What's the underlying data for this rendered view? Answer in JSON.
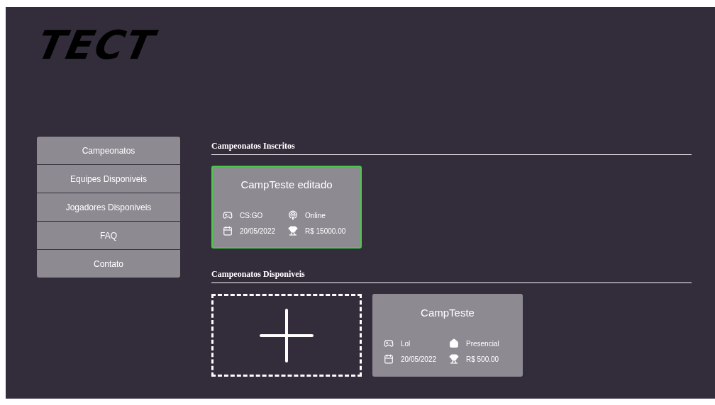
{
  "logo": {
    "text": "TECT"
  },
  "sidebar": {
    "items": [
      {
        "label": "Campeonatos"
      },
      {
        "label": "Equipes Disponiveis"
      },
      {
        "label": "Jogadores Disponiveis"
      },
      {
        "label": "FAQ"
      },
      {
        "label": "Contato"
      }
    ]
  },
  "sections": [
    {
      "title": "Campeonatos Inscritos",
      "add_card": false,
      "cards": [
        {
          "title": "CampTeste editado",
          "highlighted": true,
          "details": [
            {
              "kind": "game",
              "text": "CS:GO"
            },
            {
              "kind": "online",
              "text": "Online"
            },
            {
              "kind": "calendar",
              "text": "20/05/2022"
            },
            {
              "kind": "trophy",
              "text": "R$ 15000.00"
            }
          ]
        }
      ]
    },
    {
      "title": "Campeonatos Disponiveis",
      "add_card": true,
      "cards": [
        {
          "title": "CampTeste",
          "highlighted": false,
          "details": [
            {
              "kind": "game",
              "text": "Lol"
            },
            {
              "kind": "home",
              "text": "Presencial"
            },
            {
              "kind": "calendar",
              "text": "20/05/2022"
            },
            {
              "kind": "trophy",
              "text": "R$ 500.00"
            }
          ]
        }
      ]
    }
  ]
}
